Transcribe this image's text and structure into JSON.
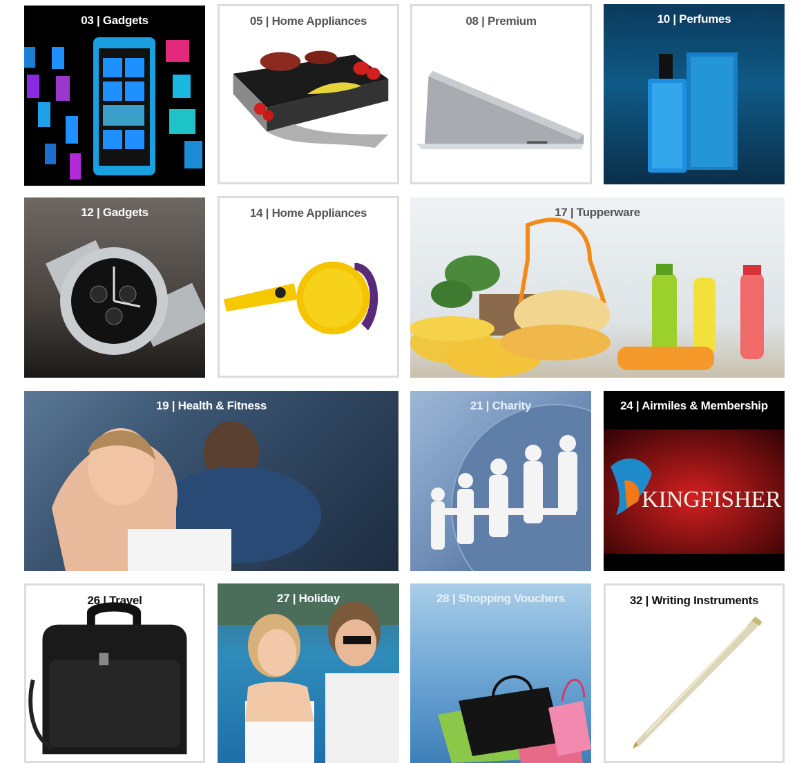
{
  "tiles": [
    {
      "id": "gadgets-03",
      "number": "03",
      "separator": "|",
      "category": "Gadgets"
    },
    {
      "id": "home-appliances-05",
      "number": "05",
      "separator": "|",
      "category": "Home Appliances"
    },
    {
      "id": "premium-08",
      "number": "08",
      "separator": "|",
      "category": "Premium"
    },
    {
      "id": "perfumes-10",
      "number": "10",
      "separator": "|",
      "category": "Perfumes"
    },
    {
      "id": "gadgets-12",
      "number": "12",
      "separator": "|",
      "category": "Gadgets"
    },
    {
      "id": "home-appliances-14",
      "number": "14",
      "separator": "|",
      "category": "Home Appliances"
    },
    {
      "id": "tupperware-17",
      "number": "17",
      "separator": "|",
      "category": "Tupperware"
    },
    {
      "id": "health-fitness-19",
      "number": "19",
      "separator": "|",
      "category": "Health & Fitness"
    },
    {
      "id": "charity-21",
      "number": "21",
      "separator": "|",
      "category": "Charity"
    },
    {
      "id": "airmiles-24",
      "number": "24",
      "separator": "|",
      "category": "Airmiles & Membership"
    },
    {
      "id": "travel-26",
      "number": "26",
      "separator": "|",
      "category": "Travel"
    },
    {
      "id": "holiday-27",
      "number": "27",
      "separator": "|",
      "category": "Holiday"
    },
    {
      "id": "shopping-28",
      "number": "28",
      "separator": "|",
      "category": "Shopping Vouchers"
    },
    {
      "id": "writing-32",
      "number": "32",
      "separator": "|",
      "category": "Writing Instruments"
    }
  ],
  "brand_text": "KINGFISHER",
  "colors": {
    "tile_border": "#dcdcdc",
    "label_gray": "#555555",
    "label_white": "#ffffff",
    "label_black": "#111111"
  }
}
